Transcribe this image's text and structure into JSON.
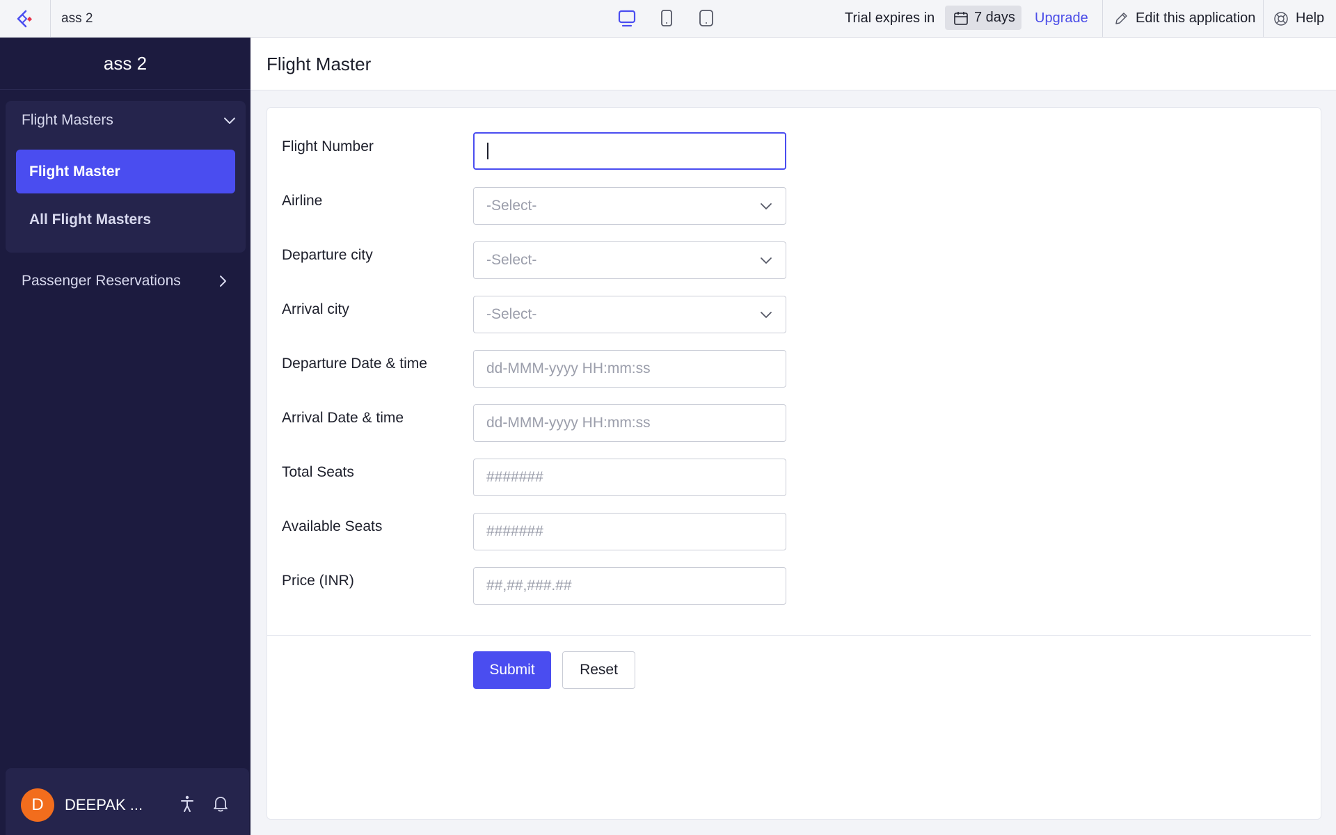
{
  "topbar": {
    "app_name": "ass 2",
    "trial_text": "Trial expires in",
    "trial_days": "7 days",
    "upgrade_label": "Upgrade",
    "edit_label": "Edit this application",
    "help_label": "Help",
    "devices": [
      "desktop-icon",
      "tablet-icon",
      "mobile-icon"
    ],
    "active_device": "desktop"
  },
  "sidebar": {
    "title": "ass 2",
    "groups": [
      {
        "label": "Flight Masters",
        "expanded": true,
        "items": [
          {
            "label": "Flight Master",
            "active": true
          },
          {
            "label": "All Flight Masters",
            "active": false
          }
        ]
      },
      {
        "label": "Passenger Reservations",
        "expanded": false
      }
    ],
    "user": {
      "initial": "D",
      "name": "DEEPAK ..."
    }
  },
  "main": {
    "page_title": "Flight Master",
    "fields": [
      {
        "label": "Flight Number",
        "type": "text",
        "value": "",
        "placeholder": ""
      },
      {
        "label": "Airline",
        "type": "select",
        "placeholder": "-Select-"
      },
      {
        "label": "Departure city",
        "type": "select",
        "placeholder": "-Select-"
      },
      {
        "label": "Arrival city",
        "type": "select",
        "placeholder": "-Select-"
      },
      {
        "label": "Departure Date & time",
        "type": "datetime",
        "placeholder": "dd-MMM-yyyy HH:mm:ss"
      },
      {
        "label": "Arrival Date & time",
        "type": "datetime",
        "placeholder": "dd-MMM-yyyy HH:mm:ss"
      },
      {
        "label": "Total Seats",
        "type": "number",
        "placeholder": "#######"
      },
      {
        "label": "Available Seats",
        "type": "number",
        "placeholder": "#######"
      },
      {
        "label": "Price (INR)",
        "type": "currency",
        "placeholder": "##,##,###.##"
      }
    ],
    "submit_label": "Submit",
    "reset_label": "Reset"
  },
  "colors": {
    "accent": "#4a4df0",
    "sidebar_bg": "#1c1b3f",
    "sidebar_group_bg": "#25244c",
    "avatar": "#f26d1d"
  }
}
